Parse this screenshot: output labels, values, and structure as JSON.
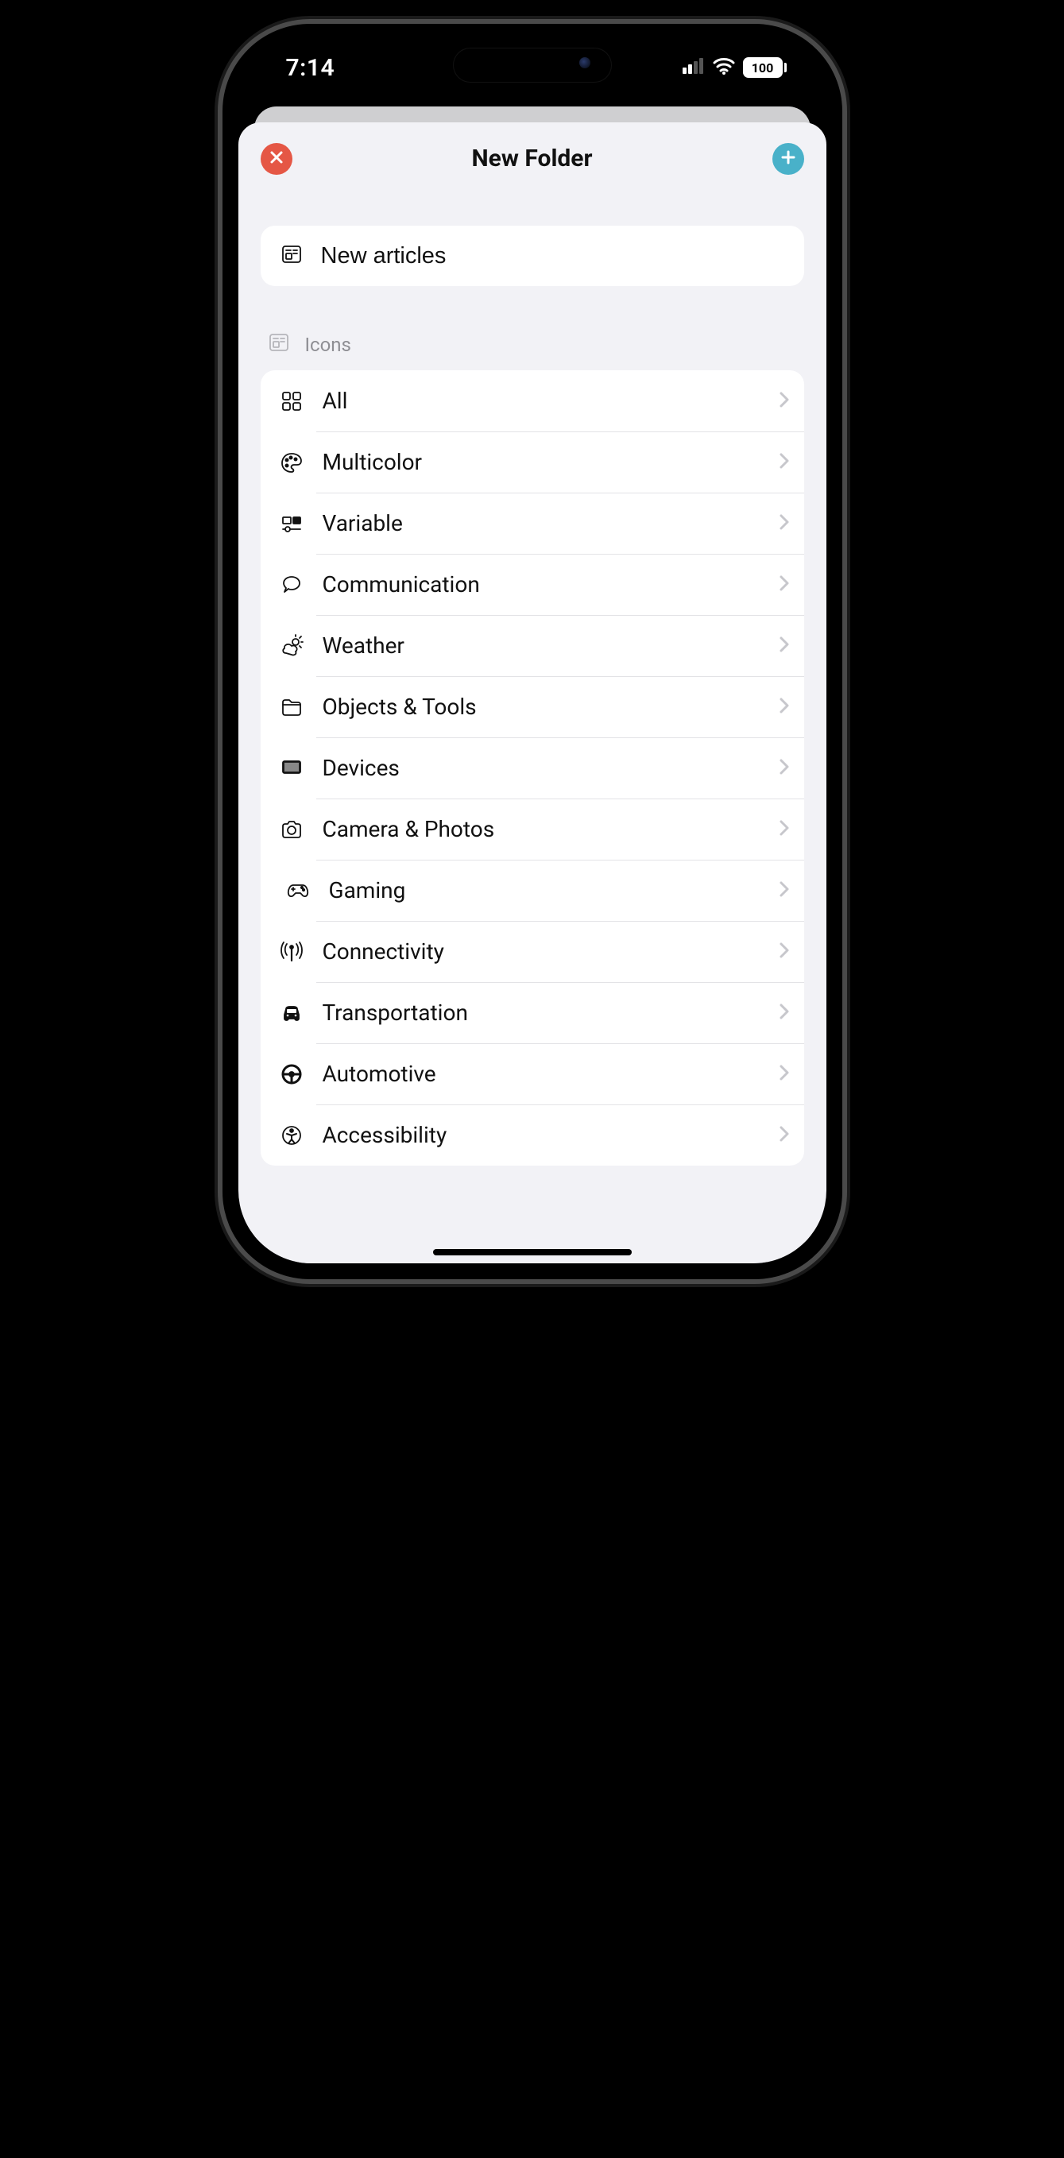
{
  "status": {
    "time": "7:14",
    "battery": "100"
  },
  "sheet": {
    "title": "New Folder",
    "folder_name": "New articles",
    "section_label": "Icons"
  },
  "categories": [
    {
      "id": "all",
      "label": "All",
      "icon": "grid-icon"
    },
    {
      "id": "multicolor",
      "label": "Multicolor",
      "icon": "palette-icon"
    },
    {
      "id": "variable",
      "label": "Variable",
      "icon": "slider-icon"
    },
    {
      "id": "communication",
      "label": "Communication",
      "icon": "speech-icon"
    },
    {
      "id": "weather",
      "label": "Weather",
      "icon": "weather-icon"
    },
    {
      "id": "objects",
      "label": "Objects & Tools",
      "icon": "folder-icon"
    },
    {
      "id": "devices",
      "label": "Devices",
      "icon": "display-icon"
    },
    {
      "id": "camera",
      "label": "Camera & Photos",
      "icon": "camera-icon"
    },
    {
      "id": "gaming",
      "label": "Gaming",
      "icon": "gamepad-icon"
    },
    {
      "id": "connectivity",
      "label": "Connectivity",
      "icon": "antenna-icon"
    },
    {
      "id": "transportation",
      "label": "Transportation",
      "icon": "car-icon"
    },
    {
      "id": "automotive",
      "label": "Automotive",
      "icon": "steering-icon"
    },
    {
      "id": "accessibility",
      "label": "Accessibility",
      "icon": "accessibility-icon"
    }
  ],
  "colors": {
    "close_btn": "#e55745",
    "add_btn": "#49b1c9",
    "sheet_bg": "#f2f2f6"
  }
}
